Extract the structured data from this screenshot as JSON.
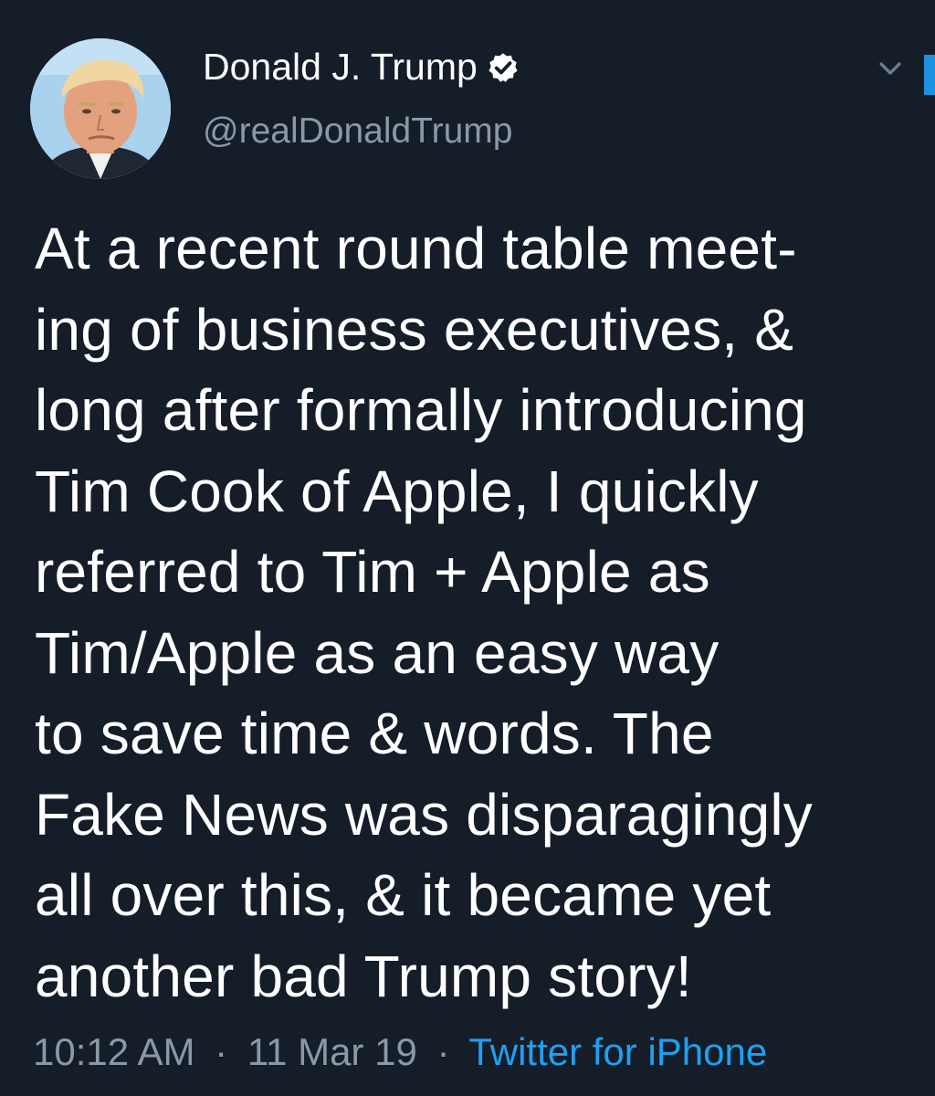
{
  "tweet": {
    "display_name": "Donald J. Trump",
    "handle": "@realDonaldTrump",
    "verified": true,
    "text_lines": [
      "At a recent round table meet-",
      "ing of business executives, &",
      "long after formally introducing",
      "Tim Cook of Apple, I quickly",
      "referred to Tim + Apple as",
      "Tim/Apple as an easy way",
      "to save time & words. The",
      "Fake News was disparagingly",
      "all over this, & it became yet",
      "another bad Trump story!"
    ],
    "time": "10:12 AM",
    "separator": "·",
    "date": "11 Mar 19",
    "source": "Twitter for iPhone"
  },
  "icons": {
    "verified": "verified-badge-icon",
    "more": "chevron-down-icon",
    "avatar": "profile-avatar"
  },
  "colors": {
    "background": "#151d29",
    "primary_text": "#ffffff",
    "secondary_text": "#8a98a8",
    "link": "#1da1f2"
  }
}
